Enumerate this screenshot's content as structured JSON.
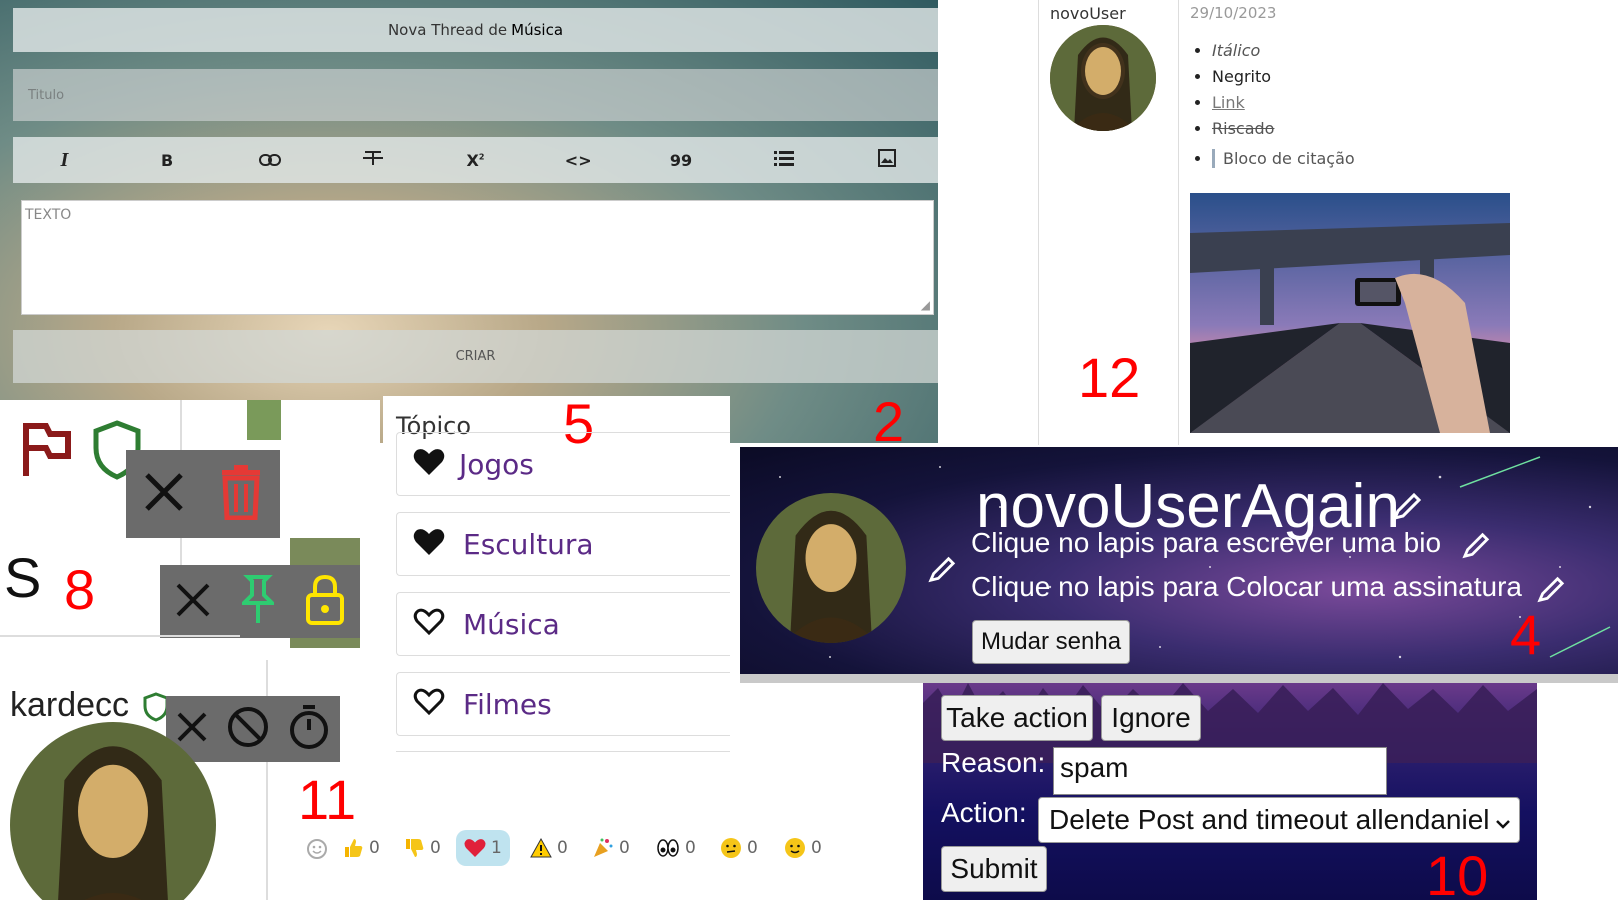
{
  "labels": {
    "p2": "2",
    "p4": "4",
    "p5": "5",
    "p8": "8",
    "p10": "10",
    "p11": "11",
    "p12": "12"
  },
  "thread_form": {
    "header_prefix": "Nova Thread de",
    "header_category": "Música",
    "title_placeholder": "Titulo",
    "text_placeholder": "TEXTO",
    "create_button": "CRIAR",
    "toolbar": [
      "italic-icon",
      "bold-icon",
      "link-icon",
      "strikethrough-icon",
      "superscript-icon",
      "code-icon",
      "quote-icon",
      "list-icon",
      "image-icon"
    ]
  },
  "post": {
    "username": "novoUser",
    "date": "29/10/2023",
    "items": [
      {
        "text": "Itálico",
        "style": "italic"
      },
      {
        "text": "Negrito",
        "style": "bold"
      },
      {
        "text": "Link",
        "style": "link"
      },
      {
        "text": "Riscado",
        "style": "strike"
      },
      {
        "text": "Bloco de citação",
        "style": "quote"
      }
    ]
  },
  "moderation": {
    "partial_letter": "S",
    "user": "kardecc",
    "icons_row1": [
      "flag-icon",
      "shield-icon"
    ],
    "bar1": [
      "close-icon",
      "trash-icon"
    ],
    "bar2": [
      "close-icon",
      "pin-icon",
      "lock-icon"
    ],
    "bar3": [
      "close-icon",
      "ban-icon",
      "timer-icon"
    ],
    "colors": {
      "flag": "#8b1a1a",
      "shield": "#2e7d32",
      "trash": "#e53935",
      "pin": "#2ecc71",
      "lock": "#ffe600",
      "bar": "#6b6b6b"
    }
  },
  "topics": {
    "label": "Tópico",
    "items": [
      {
        "name": "Jogos",
        "favorited": true
      },
      {
        "name": "Escultura",
        "favorited": true
      },
      {
        "name": "Música",
        "favorited": false
      },
      {
        "name": "Filmes",
        "favorited": false
      }
    ],
    "colors": {
      "link": "#5b2a86"
    }
  },
  "profile": {
    "username": "novoUserAgain",
    "bio_placeholder": "Clique no lapis para escrever uma bio",
    "signature_placeholder": "Clique no lapis para Colocar uma assinatura",
    "change_password_button": "Mudar senha"
  },
  "report": {
    "take_action_button": "Take action",
    "ignore_button": "Ignore",
    "reason_label": "Reason:",
    "reason_value": "spam",
    "action_label": "Action:",
    "action_selected": "Delete Post and timeout allendaniel",
    "submit_button": "Submit"
  },
  "reactions": [
    {
      "icon": "add-reaction-icon",
      "count": ""
    },
    {
      "icon": "thumbs-up-icon",
      "count": "0"
    },
    {
      "icon": "thumbs-down-icon",
      "count": "0"
    },
    {
      "icon": "heart-icon",
      "count": "1",
      "active": true
    },
    {
      "icon": "warning-icon",
      "count": "0"
    },
    {
      "icon": "party-icon",
      "count": "0"
    },
    {
      "icon": "eyes-icon",
      "count": "0"
    },
    {
      "icon": "confused-icon",
      "count": "0"
    },
    {
      "icon": "smile-icon",
      "count": "0"
    }
  ]
}
